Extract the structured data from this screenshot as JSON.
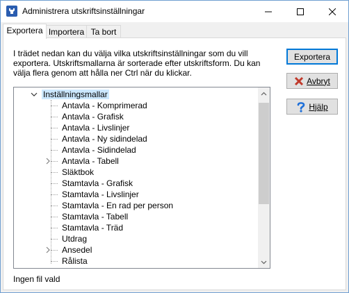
{
  "window": {
    "title": "Administrera utskriftsinställningar"
  },
  "tabs": [
    {
      "label": "Exportera",
      "active": true
    },
    {
      "label": "Importera",
      "active": false
    },
    {
      "label": "Ta bort",
      "active": false
    }
  ],
  "description": "I trädet nedan kan du välja vilka utskriftsinställningar som du vill exportera. Utskriftsmallarna är sorterade efter utskriftsform.  Du kan välja flera genom att hålla ner Ctrl när du klickar.",
  "tree": {
    "root": "Inställningsmallar",
    "items": [
      {
        "label": "Antavla - Komprimerad",
        "expandable": false
      },
      {
        "label": "Antavla - Grafisk",
        "expandable": false
      },
      {
        "label": "Antavla - Livslinjer",
        "expandable": false
      },
      {
        "label": "Antavla - Ny sidindelad",
        "expandable": false
      },
      {
        "label": "Antavla - Sidindelad",
        "expandable": false
      },
      {
        "label": "Antavla - Tabell",
        "expandable": true
      },
      {
        "label": "Släktbok",
        "expandable": false
      },
      {
        "label": "Stamtavla - Grafisk",
        "expandable": false
      },
      {
        "label": "Stamtavla - Livslinjer",
        "expandable": false
      },
      {
        "label": "Stamtavla - En rad per person",
        "expandable": false
      },
      {
        "label": "Stamtavla - Tabell",
        "expandable": false
      },
      {
        "label": "Stamtavla - Träd",
        "expandable": false
      },
      {
        "label": "Utdrag",
        "expandable": false
      },
      {
        "label": "Ansedel",
        "expandable": true
      },
      {
        "label": "Rålista",
        "expandable": false
      }
    ]
  },
  "buttons": {
    "export": "Exportera",
    "cancel": "Avbryt",
    "help": "Hjälp"
  },
  "status": "Ingen fil vald",
  "colors": {
    "selection": "#cce8ff",
    "default_button_border": "#0078d7",
    "cancel_icon": "#c0392b",
    "help_icon": "#1e6fd9"
  }
}
